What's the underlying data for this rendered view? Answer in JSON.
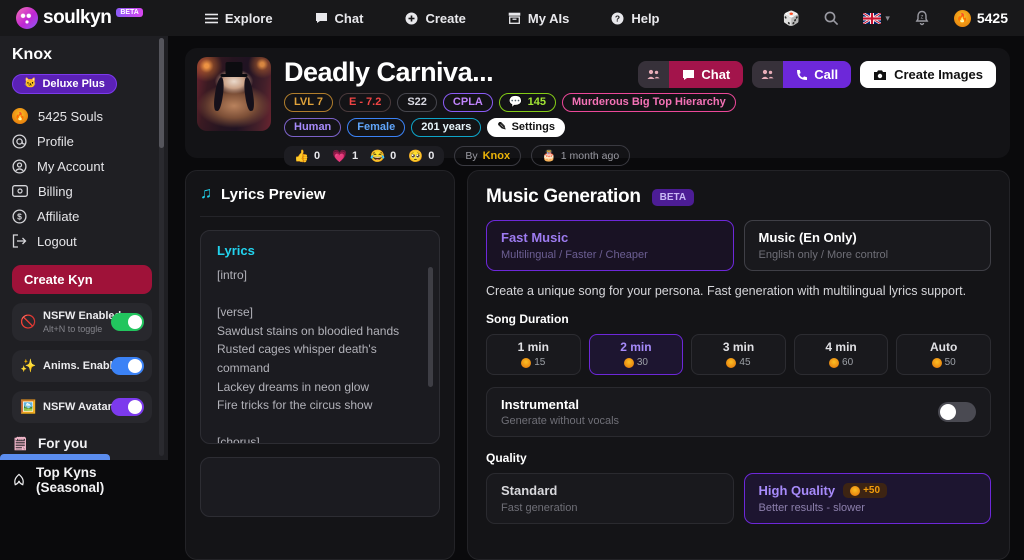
{
  "icons": {
    "flame": "🔥",
    "dice": "🎲",
    "cake": "🎂",
    "cat": "🐱",
    "nsfw": "🚫",
    "sparkles": "✨",
    "picture": "🖼️",
    "note": "♫",
    "pencil": "✎",
    "speech": "💬",
    "for_you": "🗒",
    "leaf": "🌿"
  },
  "colors": {
    "accent_purple": "#6d28d9",
    "crimson": "#a3144b",
    "toggle_green": "#22c55e",
    "toggle_blue": "#3b82f6",
    "toggle_purple": "#7c3aed",
    "orange": "#f59e0b",
    "cyan": "#22d3ee"
  },
  "topbar": {
    "logo": "soulkyn",
    "beta": "BETA",
    "nav": [
      {
        "label": "Explore"
      },
      {
        "label": "Chat"
      },
      {
        "label": "Create"
      },
      {
        "label": "My AIs"
      },
      {
        "label": "Help"
      }
    ],
    "balance": "5425"
  },
  "sidebar": {
    "username": "Knox",
    "plan": "Deluxe Plus",
    "souls": "5425 Souls",
    "menu": [
      {
        "label": "Profile"
      },
      {
        "label": "My Account"
      },
      {
        "label": "Billing"
      },
      {
        "label": "Affiliate"
      },
      {
        "label": "Logout"
      }
    ],
    "create_button": "Create Kyn",
    "toggles": [
      {
        "label": "NSFW Enabled",
        "sub": "Alt+N to toggle",
        "state": "on"
      },
      {
        "label": "Anims. Enabled",
        "state": "on"
      },
      {
        "label": "NSFW Avatar",
        "state": "on"
      }
    ],
    "sections": [
      {
        "label": "For you"
      },
      {
        "label": "Top Kyns (Seasonal)"
      }
    ]
  },
  "header": {
    "title": "Deadly Carniva...",
    "badges": [
      {
        "label": "LVL 7"
      },
      {
        "label": "E - 7.2"
      },
      {
        "label": "S22"
      },
      {
        "label": "CPLA"
      },
      {
        "label": "145",
        "icon": "💬"
      },
      {
        "label": "Murderous Big Top Hierarchy"
      },
      {
        "label": "Human"
      },
      {
        "label": "Female"
      },
      {
        "label": "201 years"
      }
    ],
    "settings_label": "Settings",
    "reactions": [
      {
        "icon": "👍",
        "count": "0"
      },
      {
        "icon": "💗",
        "count": "1"
      },
      {
        "icon": "😂",
        "count": "0"
      },
      {
        "icon": "🥺",
        "count": "0"
      }
    ],
    "by_label": "By",
    "author": "Knox",
    "created": "1 month ago",
    "actions": {
      "chat": "Chat",
      "call": "Call",
      "create_images": "Create Images"
    }
  },
  "lyrics_panel": {
    "title": "Lyrics Preview",
    "card_label": "Lyrics",
    "lyrics": "[intro]\n\n[verse]\nSawdust stains on bloodied hands\nRusted cages whisper death's command\nLackey dreams in neon glow\nFire tricks for the circus show\n\n[chorus]\nDeadly carnival spins the wheel\nHearts bleed out but the thrill is real\nClimb the wire or fall to doom\nIn this big top of twisted gloom"
  },
  "music_panel": {
    "title": "Music Generation",
    "beta": "BETA",
    "modes": [
      {
        "title": "Fast Music",
        "sub": "Multilingual / Faster / Cheaper"
      },
      {
        "title": "Music (En Only)",
        "sub": "English only / More control"
      }
    ],
    "description": "Create a unique song for your persona. Fast generation with multilingual lyrics support.",
    "duration_label": "Song Duration",
    "durations": [
      {
        "label": "1 min",
        "cost": "15"
      },
      {
        "label": "2 min",
        "cost": "30"
      },
      {
        "label": "3 min",
        "cost": "45"
      },
      {
        "label": "4 min",
        "cost": "60"
      },
      {
        "label": "Auto",
        "cost": "50"
      }
    ],
    "instrumental": {
      "title": "Instrumental",
      "sub": "Generate without vocals"
    },
    "quality_label": "Quality",
    "qualities": [
      {
        "title": "Standard",
        "sub": "Fast generation"
      },
      {
        "title": "High Quality",
        "sub": "Better results - slower",
        "badge": "+50"
      }
    ]
  }
}
